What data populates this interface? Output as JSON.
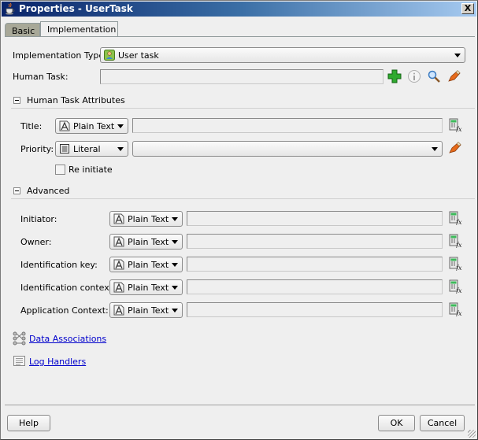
{
  "window": {
    "title": "Properties - UserTask",
    "close_label": "X"
  },
  "tabs": [
    {
      "label": "Basic",
      "active": false
    },
    {
      "label": "Implementation",
      "active": true
    }
  ],
  "implementation_type": {
    "label": "Implementation Type:",
    "value": "User task",
    "icon": "user-task-icon"
  },
  "human_task": {
    "label": "Human Task:",
    "value": "",
    "actions": [
      "add-icon",
      "info-icon",
      "search-icon",
      "edit-icon"
    ]
  },
  "human_task_attributes": {
    "section_title": "Human Task Attributes",
    "title": {
      "label": "Title:",
      "type": "Plain Text",
      "value": ""
    },
    "priority": {
      "label": "Priority:",
      "type": "Literal",
      "value": ""
    },
    "reinitiate": {
      "label": "Re initiate",
      "checked": false
    }
  },
  "advanced": {
    "section_title": "Advanced",
    "fields": [
      {
        "label": "Initiator:",
        "type": "Plain Text",
        "value": ""
      },
      {
        "label": "Owner:",
        "type": "Plain Text",
        "value": ""
      },
      {
        "label": "Identification key:",
        "type": "Plain Text",
        "value": ""
      },
      {
        "label": "Identification context:",
        "type": "Plain Text",
        "value": ""
      },
      {
        "label": "Application Context:",
        "type": "Plain Text",
        "value": ""
      }
    ]
  },
  "links": {
    "data_associations": "Data Associations",
    "log_handlers": "Log Handlers"
  },
  "footer": {
    "help": "Help",
    "ok": "OK",
    "cancel": "Cancel"
  }
}
